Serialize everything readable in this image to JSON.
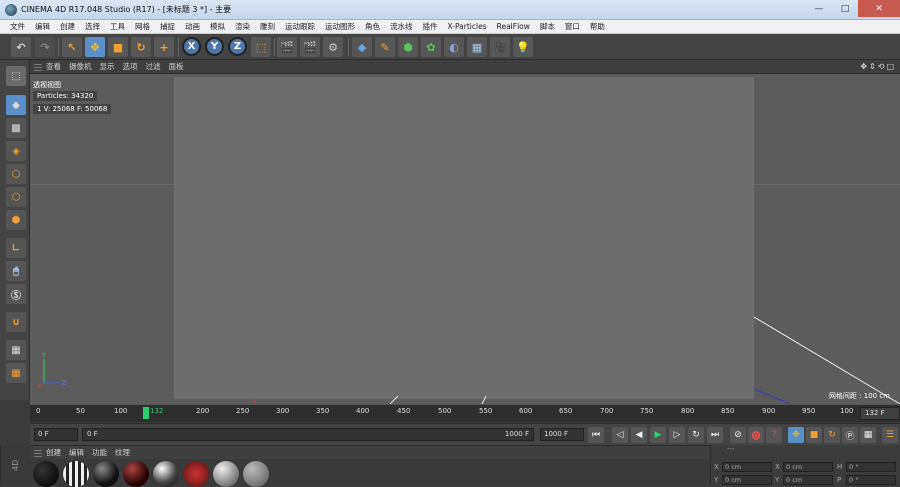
{
  "window": {
    "title": "CINEMA 4D R17.048 Studio (R17) - [未标题 3 *] - 主要",
    "controls": [
      "—",
      "□",
      "✕"
    ]
  },
  "menubar": [
    "文件",
    "编辑",
    "创建",
    "选择",
    "工具",
    "网格",
    "捕捉",
    "动画",
    "模拟",
    "渲染",
    "雕刻",
    "运动跟踪",
    "运动图形",
    "角色",
    "流水线",
    "插件",
    "X-Particles",
    "RealFlow",
    "脚本",
    "窗口",
    "帮助"
  ],
  "toolbar": {
    "axis_x": "X",
    "axis_y": "Y",
    "axis_z": "Z"
  },
  "viewport_menu": [
    "查看",
    "摄像机",
    "显示",
    "选项",
    "过滤",
    "面板"
  ],
  "viewport": {
    "label": "透视视图",
    "hud_particles": "Particles: 34320",
    "hud_stats": "1 V: 25068 F: 50068",
    "grid_readout": "网格间距 : 100 cm",
    "axis_y": "Y",
    "axis_z": "Z"
  },
  "timeline": {
    "ticks": [
      "0",
      "50",
      "100",
      "132",
      "200",
      "250",
      "300",
      "350",
      "400",
      "450",
      "500",
      "550",
      "600",
      "650",
      "700",
      "750",
      "800",
      "850",
      "900",
      "950",
      "100"
    ],
    "current_frame": "132 F",
    "playhead_label": "132"
  },
  "transport": {
    "start": "0 F",
    "range_start": "0 F",
    "range_end": "1000 F",
    "end": "1000 F"
  },
  "materials_menu": [
    "创建",
    "编辑",
    "功能",
    "纹理"
  ],
  "side_tab": "4D",
  "coordinates": {
    "header": "---",
    "rows": [
      {
        "axis": "X",
        "pos": "0 cm",
        "rot_axis": "X",
        "rot": "0 cm",
        "h_axis": "H",
        "h": "0 °"
      },
      {
        "axis": "Y",
        "pos": "0 cm",
        "rot_axis": "Y",
        "rot": "0 cm",
        "h_axis": "P",
        "h": "0 °"
      }
    ]
  },
  "colors": {
    "accent": "#5a8fc8",
    "viewport_bg": "#5c5c5c",
    "safe_frame": "#6e6e6e",
    "playhead": "#2ecc71"
  }
}
